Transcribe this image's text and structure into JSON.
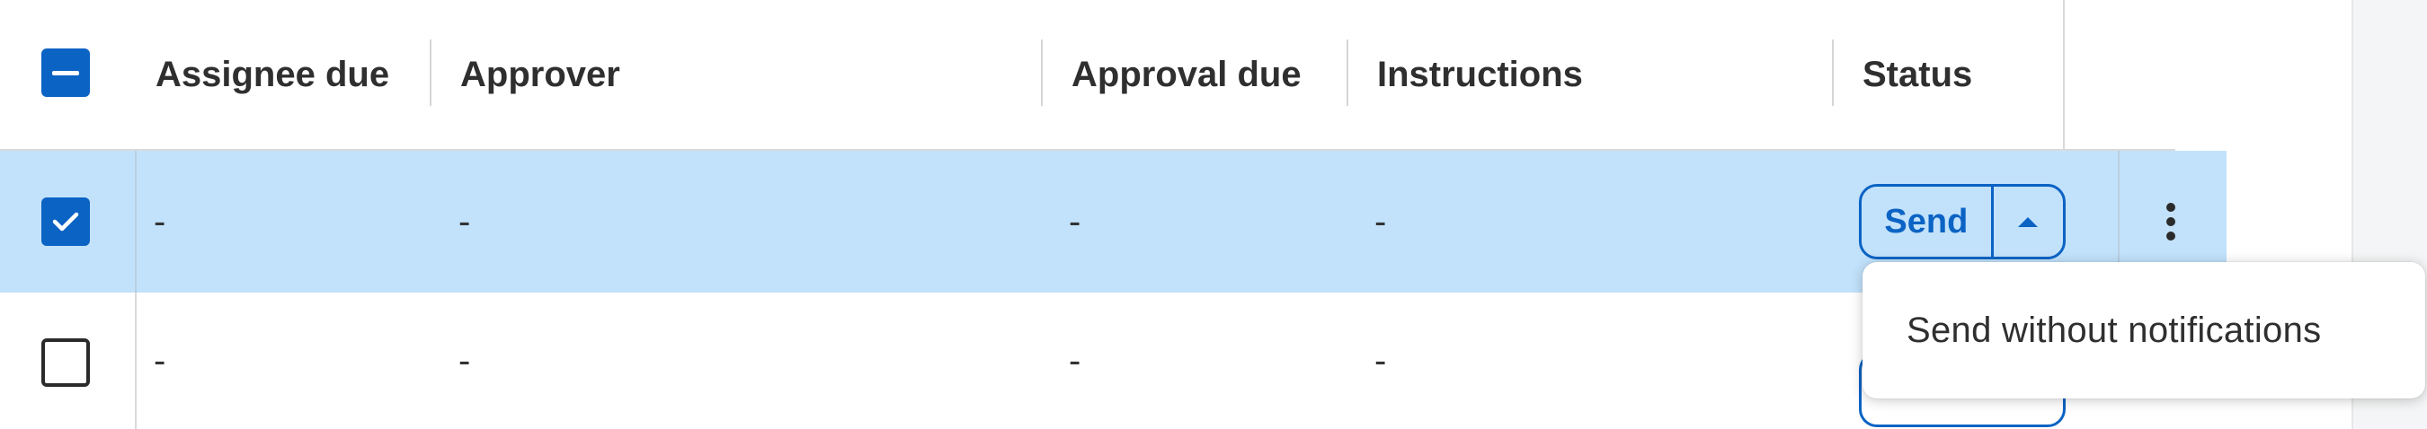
{
  "table": {
    "headers": {
      "assignee_due": "Assignee due",
      "approver": "Approver",
      "approval_due": "Approval due",
      "instructions": "Instructions",
      "status": "Status"
    },
    "rows": [
      {
        "selected": true,
        "assignee_due": "-",
        "approver": "-",
        "approval_due": "-",
        "instructions": "-",
        "status_button_label": "Send"
      },
      {
        "selected": false,
        "assignee_due": "-",
        "approver": "-",
        "approval_due": "-",
        "instructions": "-"
      }
    ]
  },
  "send_menu": {
    "items": [
      {
        "label": "Send without notifications"
      }
    ]
  },
  "icons": {
    "header_checkbox": "checkbox-indeterminate-icon",
    "row_checkbox_checked": "checkbox-checked-icon",
    "row_checkbox_unchecked": "checkbox-unchecked-icon",
    "caret": "caret-up-icon",
    "more": "kebab-menu-icon"
  },
  "colors": {
    "accent": "#0b63c4",
    "selected_row": "#c2e2fb",
    "text": "#2b2b2b"
  }
}
